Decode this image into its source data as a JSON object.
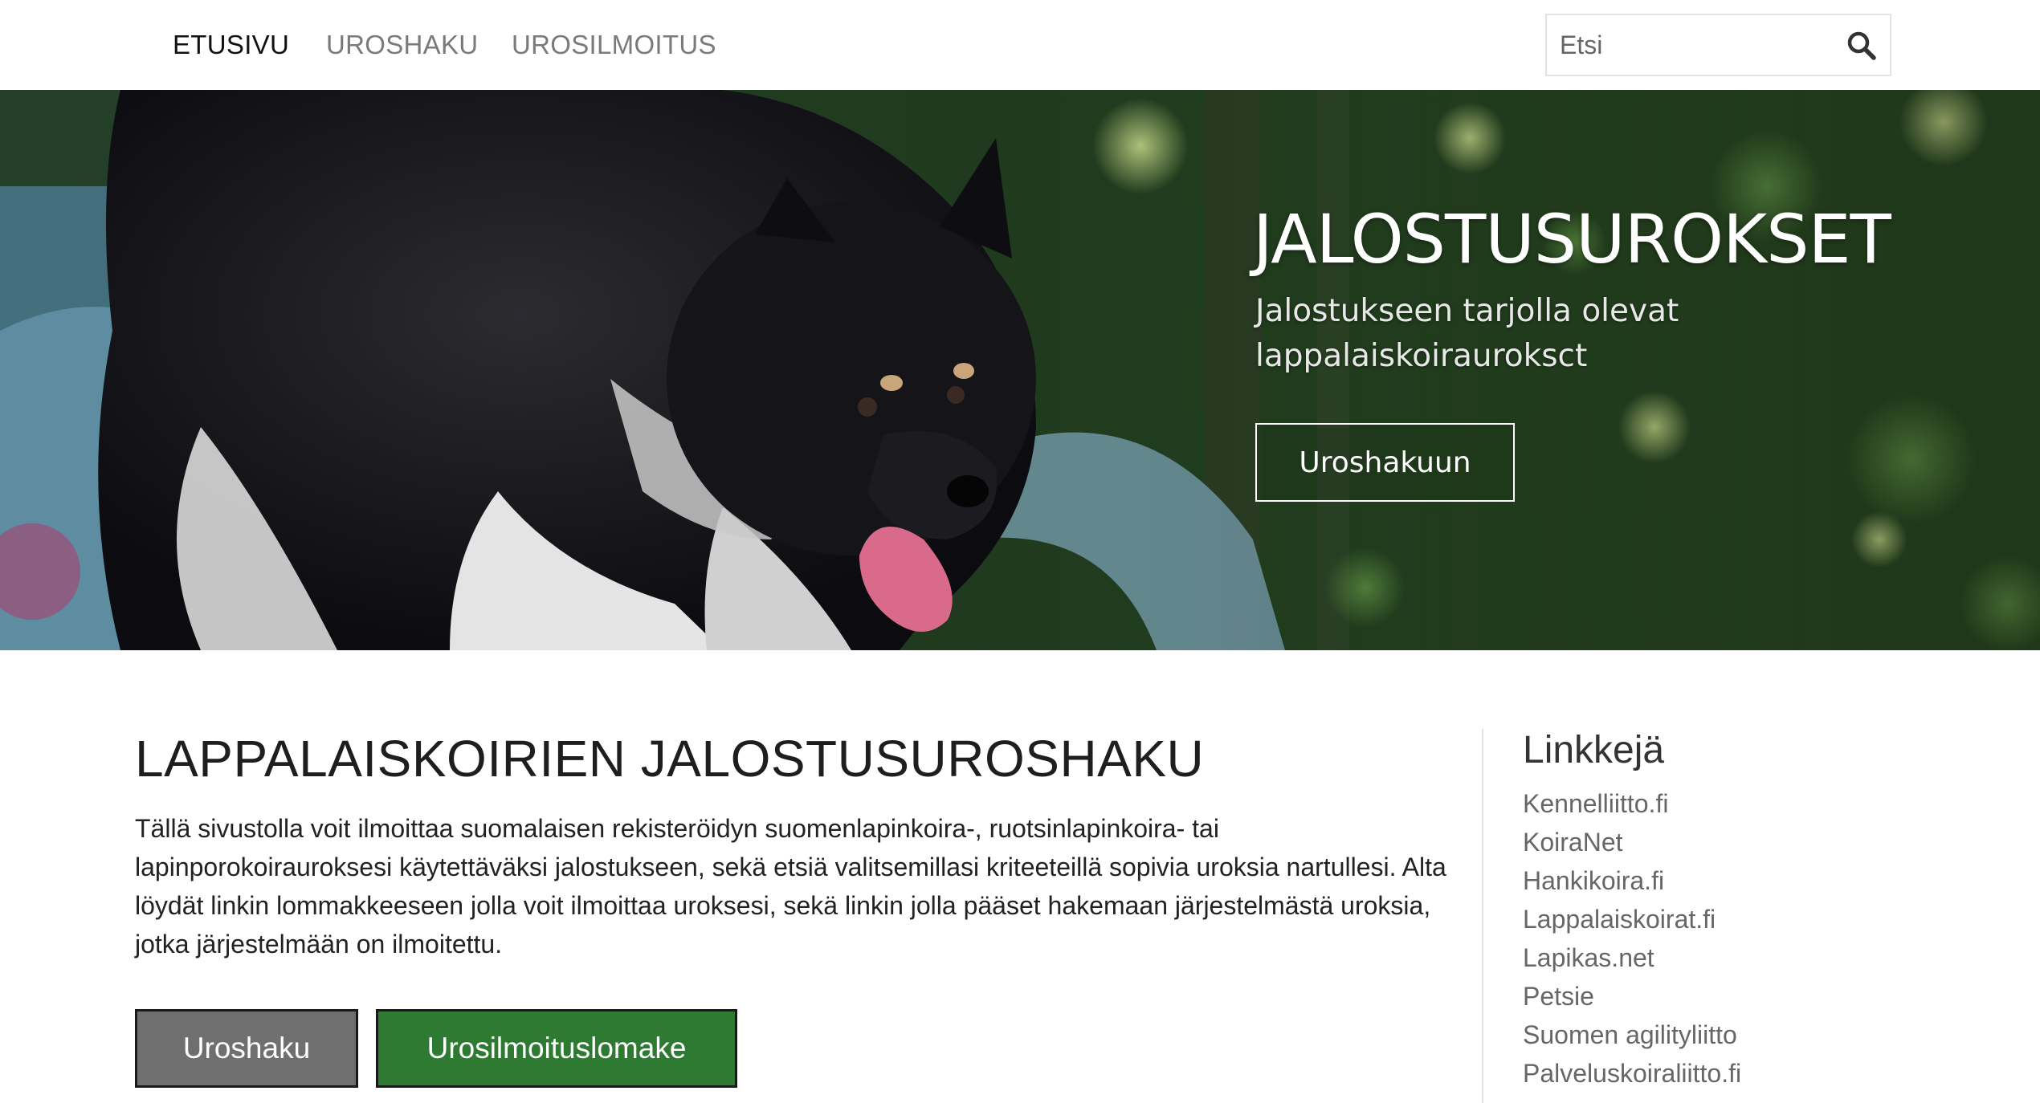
{
  "nav": {
    "items": [
      {
        "label": "ETUSIVU",
        "active": true
      },
      {
        "label": "UROSHAKU",
        "active": false
      },
      {
        "label": "UROSILMOITUS",
        "active": false
      }
    ],
    "search_placeholder": "Etsi",
    "search_icon": "search-icon"
  },
  "hero": {
    "title": "JALOSTUSUROKSET",
    "subtitle": "Jalostukseen tarjolla olevat lappalaiskoirauroksct",
    "cta_label": "Uroshakuun"
  },
  "main": {
    "heading": "LAPPALAISKOIRIEN JALOSTUSUROSHAKU",
    "intro": "Tällä sivustolla voit ilmoittaa suomalaisen rekisteröidyn suomenlapinkoira-, ruotsinlapinkoira- tai lapinporokoirauroksesi käytettäväksi jalostukseen, sekä etsiä valitsemillasi kriteeteillä sopivia uroksia nartullesi. Alta löydät linkin lommakkeeseen jolla voit ilmoittaa uroksesi, sekä linkin jolla pääset hakemaan järjestelmästä uroksia, jotka järjestelmään on ilmoitettu.",
    "buttons": [
      {
        "label": "Uroshaku",
        "color": "#6f6f6f"
      },
      {
        "label": "Urosilmoituslomake",
        "color": "#2f7a33"
      }
    ]
  },
  "sidebar": {
    "title": "Linkkejä",
    "links": [
      "Kennelliitto.fi",
      "KoiraNet",
      "Hankikoira.fi",
      "Lappalaiskoirat.fi",
      "Lapikas.net",
      "Petsie",
      "Suomen agilityliitto",
      "Palveluskoiraliitto.fi"
    ]
  },
  "colors": {
    "nav_active": "#111111",
    "nav_inactive": "#7a7a7a",
    "button_gray": "#6f6f6f",
    "button_green": "#2f7a33",
    "link": "#666666"
  }
}
